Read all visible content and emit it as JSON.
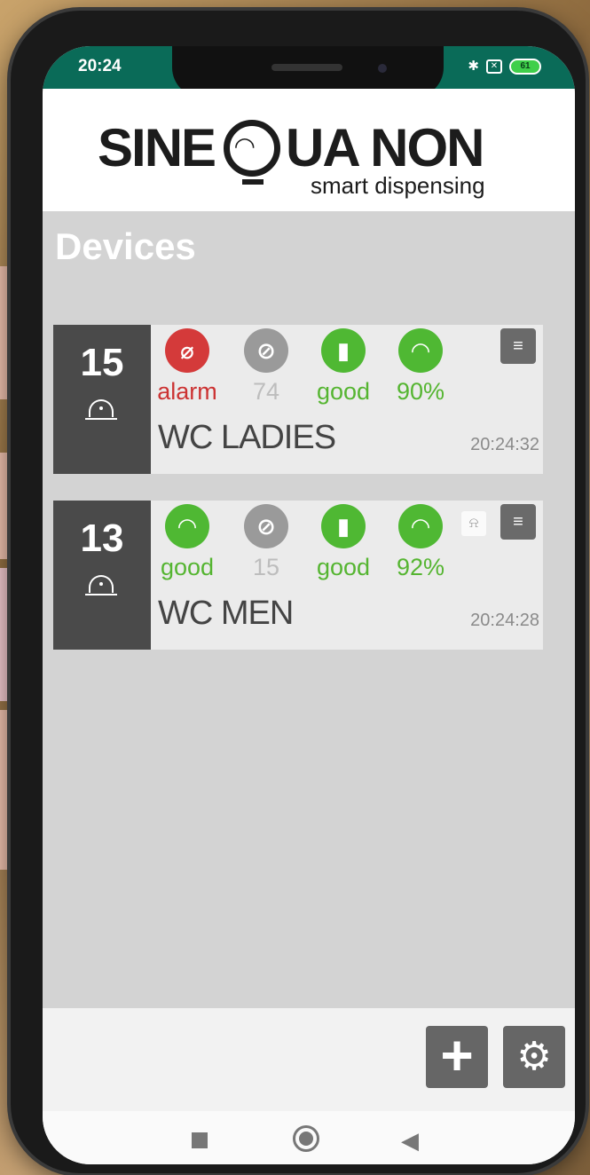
{
  "status_bar": {
    "time": "20:24",
    "bluetooth_icon": "bluetooth-icon",
    "sim_icon": "sim-icon",
    "battery_level": "61"
  },
  "header": {
    "logo_main_left": "SINE",
    "logo_main_right": "UA NON",
    "logo_sub": "smart dispensing"
  },
  "page": {
    "title": "Devices"
  },
  "devices": [
    {
      "number": "15",
      "status_label": "alarm",
      "paper_value": "74",
      "battery_label": "good",
      "signal_label": "90%",
      "name": "WC LADIES",
      "timestamp": "20:24:32"
    },
    {
      "number": "13",
      "status_label": "good",
      "paper_value": "15",
      "battery_label": "good",
      "signal_label": "92%",
      "name": "WC MEN",
      "timestamp": "20:24:28"
    }
  ],
  "colors": {
    "status_bar": "#0a6b58",
    "alarm": "#d43a3a",
    "ok": "#4fb833",
    "neutral": "#9a9a9a",
    "card_left": "#4a4a4a"
  },
  "toolbar": {
    "add_icon": "plus-icon",
    "settings_icon": "gear-icon"
  }
}
